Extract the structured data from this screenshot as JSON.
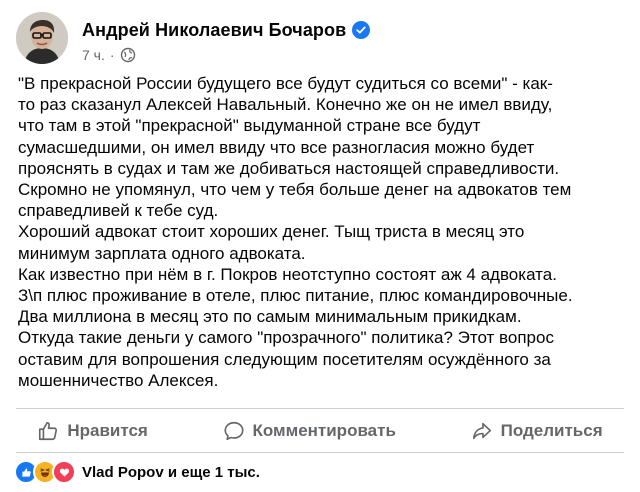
{
  "post": {
    "author": "Андрей Николаевич Бочаров",
    "time": "7 ч.",
    "separator": "·",
    "text_lines": [
      "\"В прекрасной России будущего все будут судиться со всеми\" - как-",
      "то раз сказанул Алексей Навальный. Конечно же он не имел ввиду,",
      "что там в этой \"прекрасной\" выдуманной стране все будут",
      "сумасшедшими, он имел ввиду что все разногласия можно будет",
      "прояснять в судах и там же добиваться настоящей справедливости.",
      "Скромно не упомянул, что чем у тебя больше денег на адвокатов тем",
      "справедливей к тебе суд.",
      "Хороший адвокат стоит хороших денег. Тыщ триста в месяц это",
      "минимум зарплата одного адвоката.",
      "Как известно при нём в г. Покров неотступно состоят аж 4 адвоката.",
      "З\\п плюс проживание в отеле, плюс питание, плюс командировочные.",
      "Два миллиона в месяц это по самым минимальным прикидкам.",
      "Откуда такие деньги у самого \"прозрачного\" политика? Этот вопрос",
      "оставим для вопрошения следующим посетителям осуждённого за",
      "мошенничество Алексея."
    ]
  },
  "actions": {
    "like": "Нравится",
    "comment": "Комментировать",
    "share": "Поделиться"
  },
  "reactions": {
    "summary": "Vlad Popov и еще 1 тыс.",
    "icons": [
      "like-icon",
      "haha-icon",
      "love-icon"
    ]
  },
  "colors": {
    "verified": "#1877f2",
    "secondary_text": "#65676b",
    "like": "#1877f2",
    "haha": "#f7b125",
    "love": "#f33e58"
  }
}
